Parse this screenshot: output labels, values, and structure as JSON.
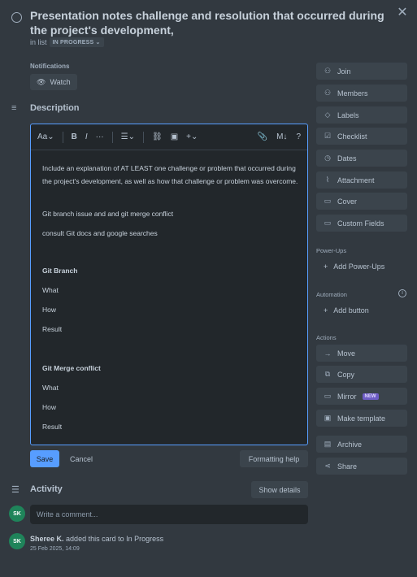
{
  "card": {
    "title": "Presentation notes challenge and resolution that occurred during the project's development,",
    "in_list_prefix": "in list",
    "list_name": "IN PROGRESS",
    "close_icon": "close-icon"
  },
  "notifications": {
    "label": "Notifications",
    "watch_label": "Watch"
  },
  "description": {
    "title": "Description",
    "toolbar": {
      "text_style": "Aa",
      "bold": "B",
      "italic": "I",
      "more": "···",
      "list": "☰",
      "link": "🔗",
      "image": "▣",
      "insert": "+",
      "markdown": "M↓",
      "help": "?"
    },
    "content": {
      "p1": "Include an explanation of AT LEAST one challenge or problem that occurred during the project's development, as well as how that challenge or problem was overcome.",
      "p2": "Git branch  issue and and git merge conflict",
      "p3": "consult Git docs and google searches",
      "h1": "Git Branch",
      "a1": "What",
      "a2": "How",
      "a3": "Result",
      "h2": "Git Merge conflict",
      "b1": "What",
      "b2": "How",
      "b3": "Result"
    },
    "save_label": "Save",
    "cancel_label": "Cancel",
    "formatting_help_label": "Formatting help"
  },
  "activity": {
    "title": "Activity",
    "show_details_label": "Show details",
    "comment_placeholder": "Write a comment...",
    "avatar_initials": "SK",
    "log": {
      "user": "Sheree K.",
      "action": "added this card to In Progress",
      "time": "25 Feb 2025, 14:09"
    }
  },
  "sidebar": {
    "add_to_card": [
      "Join",
      "Members",
      "Labels",
      "Checklist",
      "Dates",
      "Attachment",
      "Cover",
      "Custom Fields"
    ],
    "powerups_label": "Power-Ups",
    "add_powerups": "Add Power-Ups",
    "automation_label": "Automation",
    "add_button": "Add button",
    "actions_label": "Actions",
    "actions": [
      "Move",
      "Copy",
      "Mirror",
      "Make template"
    ],
    "mirror_badge": "NEW",
    "archive_label": "Archive",
    "share_label": "Share"
  },
  "colors": {
    "accent": "#579dff",
    "background": "#323940",
    "button": "#3b444c",
    "avatar": "#1f845a"
  }
}
